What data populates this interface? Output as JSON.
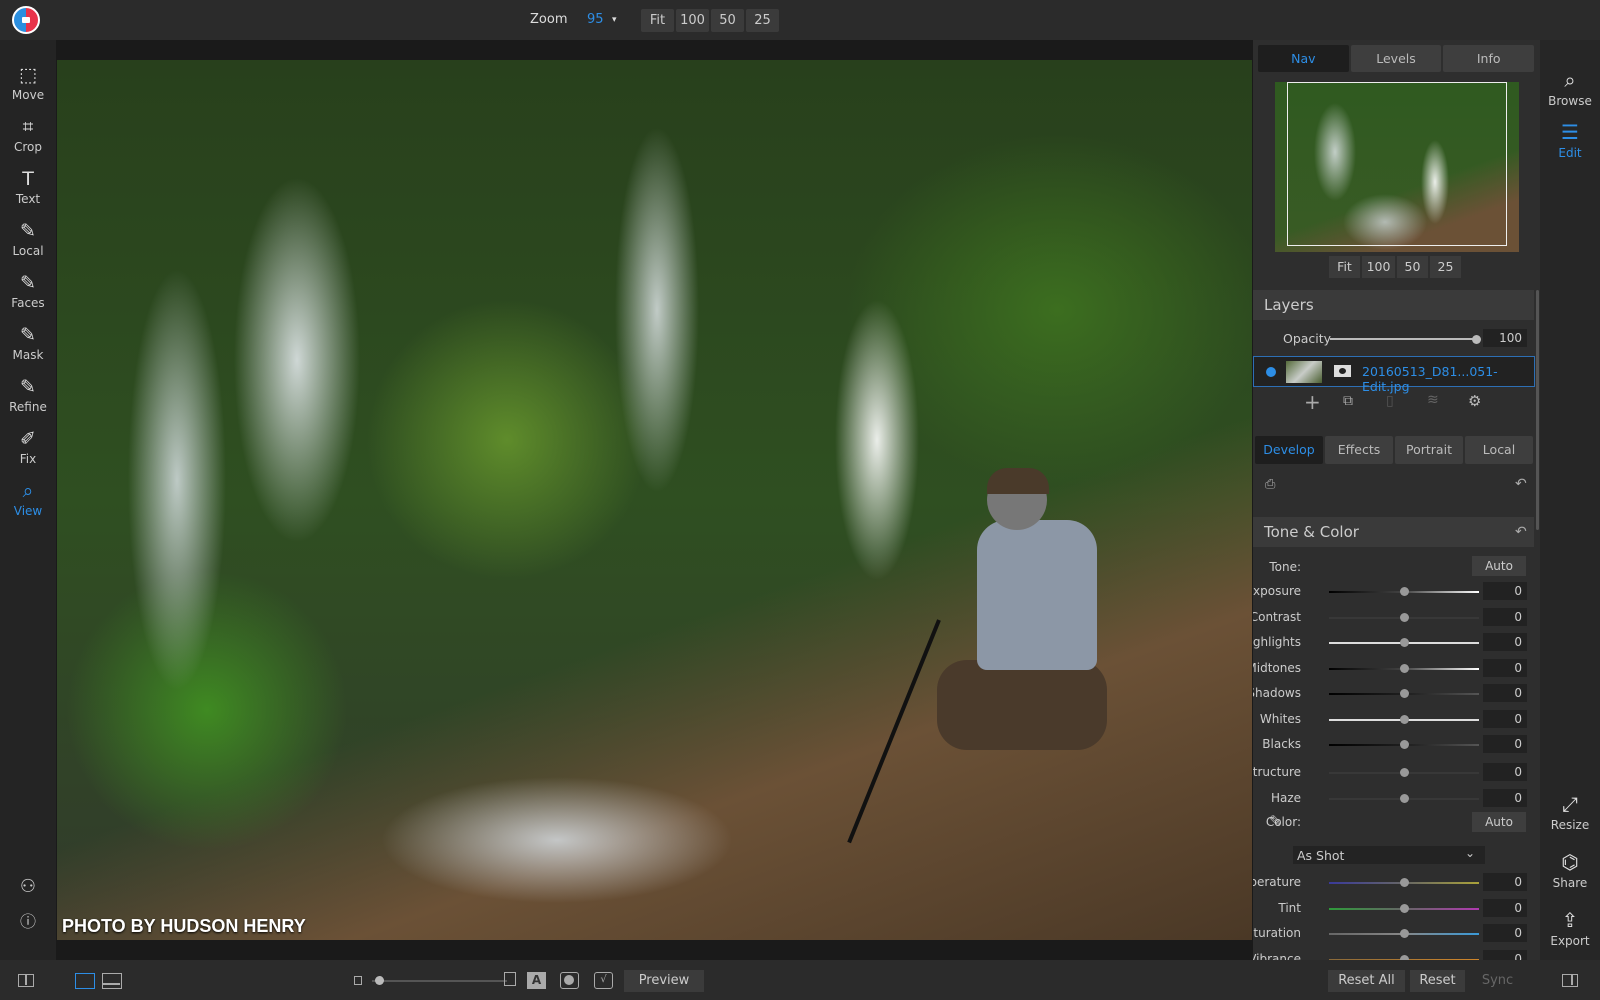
{
  "topbar": {
    "zoom_label": "Zoom",
    "zoom_value": "95",
    "zoom_buttons": [
      "Fit",
      "100",
      "50",
      "25"
    ]
  },
  "left_tools": [
    {
      "label": "Move",
      "icon": "⬚"
    },
    {
      "label": "Crop",
      "icon": "⌗"
    },
    {
      "label": "Text",
      "icon": "T"
    },
    {
      "label": "Local",
      "icon": "✎"
    },
    {
      "label": "Faces",
      "icon": "✎"
    },
    {
      "label": "Mask",
      "icon": "✎"
    },
    {
      "label": "Refine",
      "icon": "✎"
    },
    {
      "label": "Fix",
      "icon": "✐"
    },
    {
      "label": "View",
      "icon": "⌕",
      "active": true
    }
  ],
  "left_bottom_icons": [
    "user-icon",
    "help-icon"
  ],
  "photo": {
    "caption": "PHOTO BY HUDSON HENRY"
  },
  "panel": {
    "top_tabs": [
      "Nav",
      "Levels",
      "Info"
    ],
    "active_top_tab": "Nav",
    "nav_buttons": [
      "Fit",
      "100",
      "50",
      "25"
    ],
    "layers": {
      "title": "Layers",
      "opacity_label": "Opacity",
      "opacity_value": "100",
      "layer_name": "20160513_D81...051-Edit.jpg"
    },
    "edit_tabs": [
      "Develop",
      "Effects",
      "Portrait",
      "Local"
    ],
    "active_edit_tab": "Develop",
    "tone_color": {
      "title": "Tone & Color",
      "tone_label": "Tone:",
      "color_label": "Color:",
      "auto_label": "Auto",
      "white_balance": "As Shot",
      "tone_sliders": [
        {
          "label": "Exposure",
          "value": "0",
          "style": "bw"
        },
        {
          "label": "Contrast",
          "value": "0",
          "style": "dim"
        },
        {
          "label": "Highlights",
          "value": "0",
          "style": "white"
        },
        {
          "label": "Midtones",
          "value": "0",
          "style": "bw"
        },
        {
          "label": "Shadows",
          "value": "0",
          "style": "dark"
        },
        {
          "label": "Whites",
          "value": "0",
          "style": "white"
        },
        {
          "label": "Blacks",
          "value": "0",
          "style": "dark"
        }
      ],
      "detail_sliders": [
        {
          "label": "Structure",
          "value": "0",
          "style": "dim"
        },
        {
          "label": "Haze",
          "value": "0",
          "style": "dim"
        }
      ],
      "color_sliders": [
        {
          "label": "Temperature",
          "value": "0",
          "style": "temp"
        },
        {
          "label": "Tint",
          "value": "0",
          "style": "tint"
        },
        {
          "label": "Saturation",
          "value": "0",
          "style": "sat"
        },
        {
          "label": "Vibrance",
          "value": "0",
          "style": "vib"
        }
      ]
    }
  },
  "right_rail": {
    "top": [
      {
        "label": "Browse",
        "icon": "⌕"
      },
      {
        "label": "Edit",
        "icon": "☰",
        "active": true
      }
    ],
    "bottom": [
      {
        "label": "Resize",
        "icon": "⤢"
      },
      {
        "label": "Share",
        "icon": "⌬"
      },
      {
        "label": "Export",
        "icon": "⇪"
      }
    ]
  },
  "bottombar": {
    "preview": "Preview",
    "reset_all": "Reset All",
    "reset": "Reset",
    "sync": "Sync"
  },
  "colors": {
    "accent": "#2d8ee6",
    "panel": "#2e2e2e"
  }
}
